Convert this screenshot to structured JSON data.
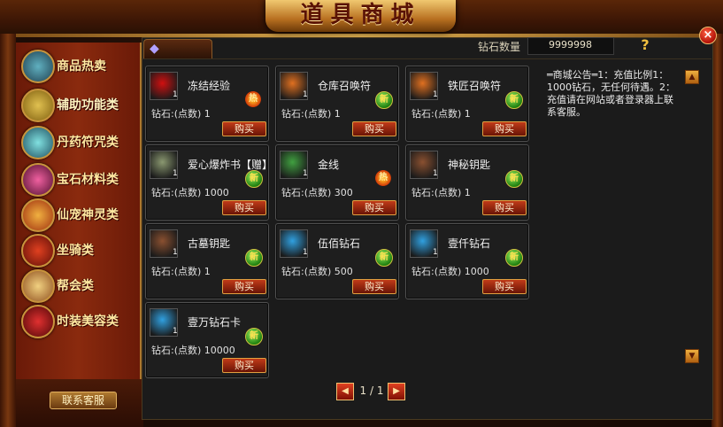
{
  "window": {
    "title": "道具商城",
    "close_icon": "close-icon"
  },
  "header": {
    "diamond_label": "钻石数量",
    "diamond_value": "9999998"
  },
  "sidebar": {
    "items": [
      {
        "label": "商品热卖",
        "icon": "hot-goods-icon"
      },
      {
        "label": "辅助功能类",
        "icon": "scroll-book-icon"
      },
      {
        "label": "丹药符咒类",
        "icon": "pill-orb-icon"
      },
      {
        "label": "宝石材料类",
        "icon": "gem-icon"
      },
      {
        "label": "仙宠神灵类",
        "icon": "pet-icon"
      },
      {
        "label": "坐骑类",
        "icon": "mount-icon"
      },
      {
        "label": "帮会类",
        "icon": "guild-icon"
      },
      {
        "label": "时装美容类",
        "icon": "fashion-icon"
      }
    ],
    "contact": "联系客服"
  },
  "items": [
    {
      "name": "冻结经验",
      "price": "钻石:(点数) 1",
      "qty": "1",
      "badge": "热",
      "badge_type": "hot",
      "icon": "red-x-icon",
      "color": "#d01010"
    },
    {
      "name": "仓库召唤符",
      "price": "钻石:(点数) 1",
      "qty": "1",
      "badge": "新",
      "badge_type": "new",
      "icon": "lion-icon",
      "color": "#e07020"
    },
    {
      "name": "铁匠召唤符",
      "price": "钻石:(点数) 1",
      "qty": "1",
      "badge": "新",
      "badge_type": "new",
      "icon": "lion-icon",
      "color": "#e07020"
    },
    {
      "name": "爱心爆炸书【赠】",
      "price": "钻石:(点数) 1000",
      "qty": "1",
      "badge": "新",
      "badge_type": "new",
      "icon": "book-stack-icon",
      "color": "#8a9870"
    },
    {
      "name": "金线",
      "price": "钻石:(点数) 300",
      "qty": "1",
      "badge": "热",
      "badge_type": "hot",
      "icon": "thread-icon",
      "color": "#40a040"
    },
    {
      "name": "神秘钥匙",
      "price": "钻石:(点数) 1",
      "qty": "1",
      "badge": "新",
      "badge_type": "new",
      "icon": "key-icon",
      "color": "#8a5030"
    },
    {
      "name": "古墓钥匙",
      "price": "钻石:(点数) 1",
      "qty": "1",
      "badge": "新",
      "badge_type": "new",
      "icon": "key-icon",
      "color": "#8a5030"
    },
    {
      "name": "伍佰钻石",
      "price": "钻石:(点数) 500",
      "qty": "1",
      "badge": "新",
      "badge_type": "new",
      "icon": "diamond-icon",
      "color": "#30a0e0"
    },
    {
      "name": "壹仟钻石",
      "price": "钻石:(点数) 1000",
      "qty": "1",
      "badge": "新",
      "badge_type": "new",
      "icon": "diamond-icon",
      "color": "#30a0e0"
    },
    {
      "name": "壹万钻石卡",
      "price": "钻石:(点数) 10000",
      "qty": "1",
      "badge": "新",
      "badge_type": "new",
      "icon": "diamond-icon",
      "color": "#30a0e0"
    }
  ],
  "buy_label": "购买",
  "notice": "═商城公告═1：充值比例1：1000钻石，无任何待遇。2：充值请在网站或者登录器上联系客服。",
  "pager": {
    "text": "1 / 1"
  }
}
